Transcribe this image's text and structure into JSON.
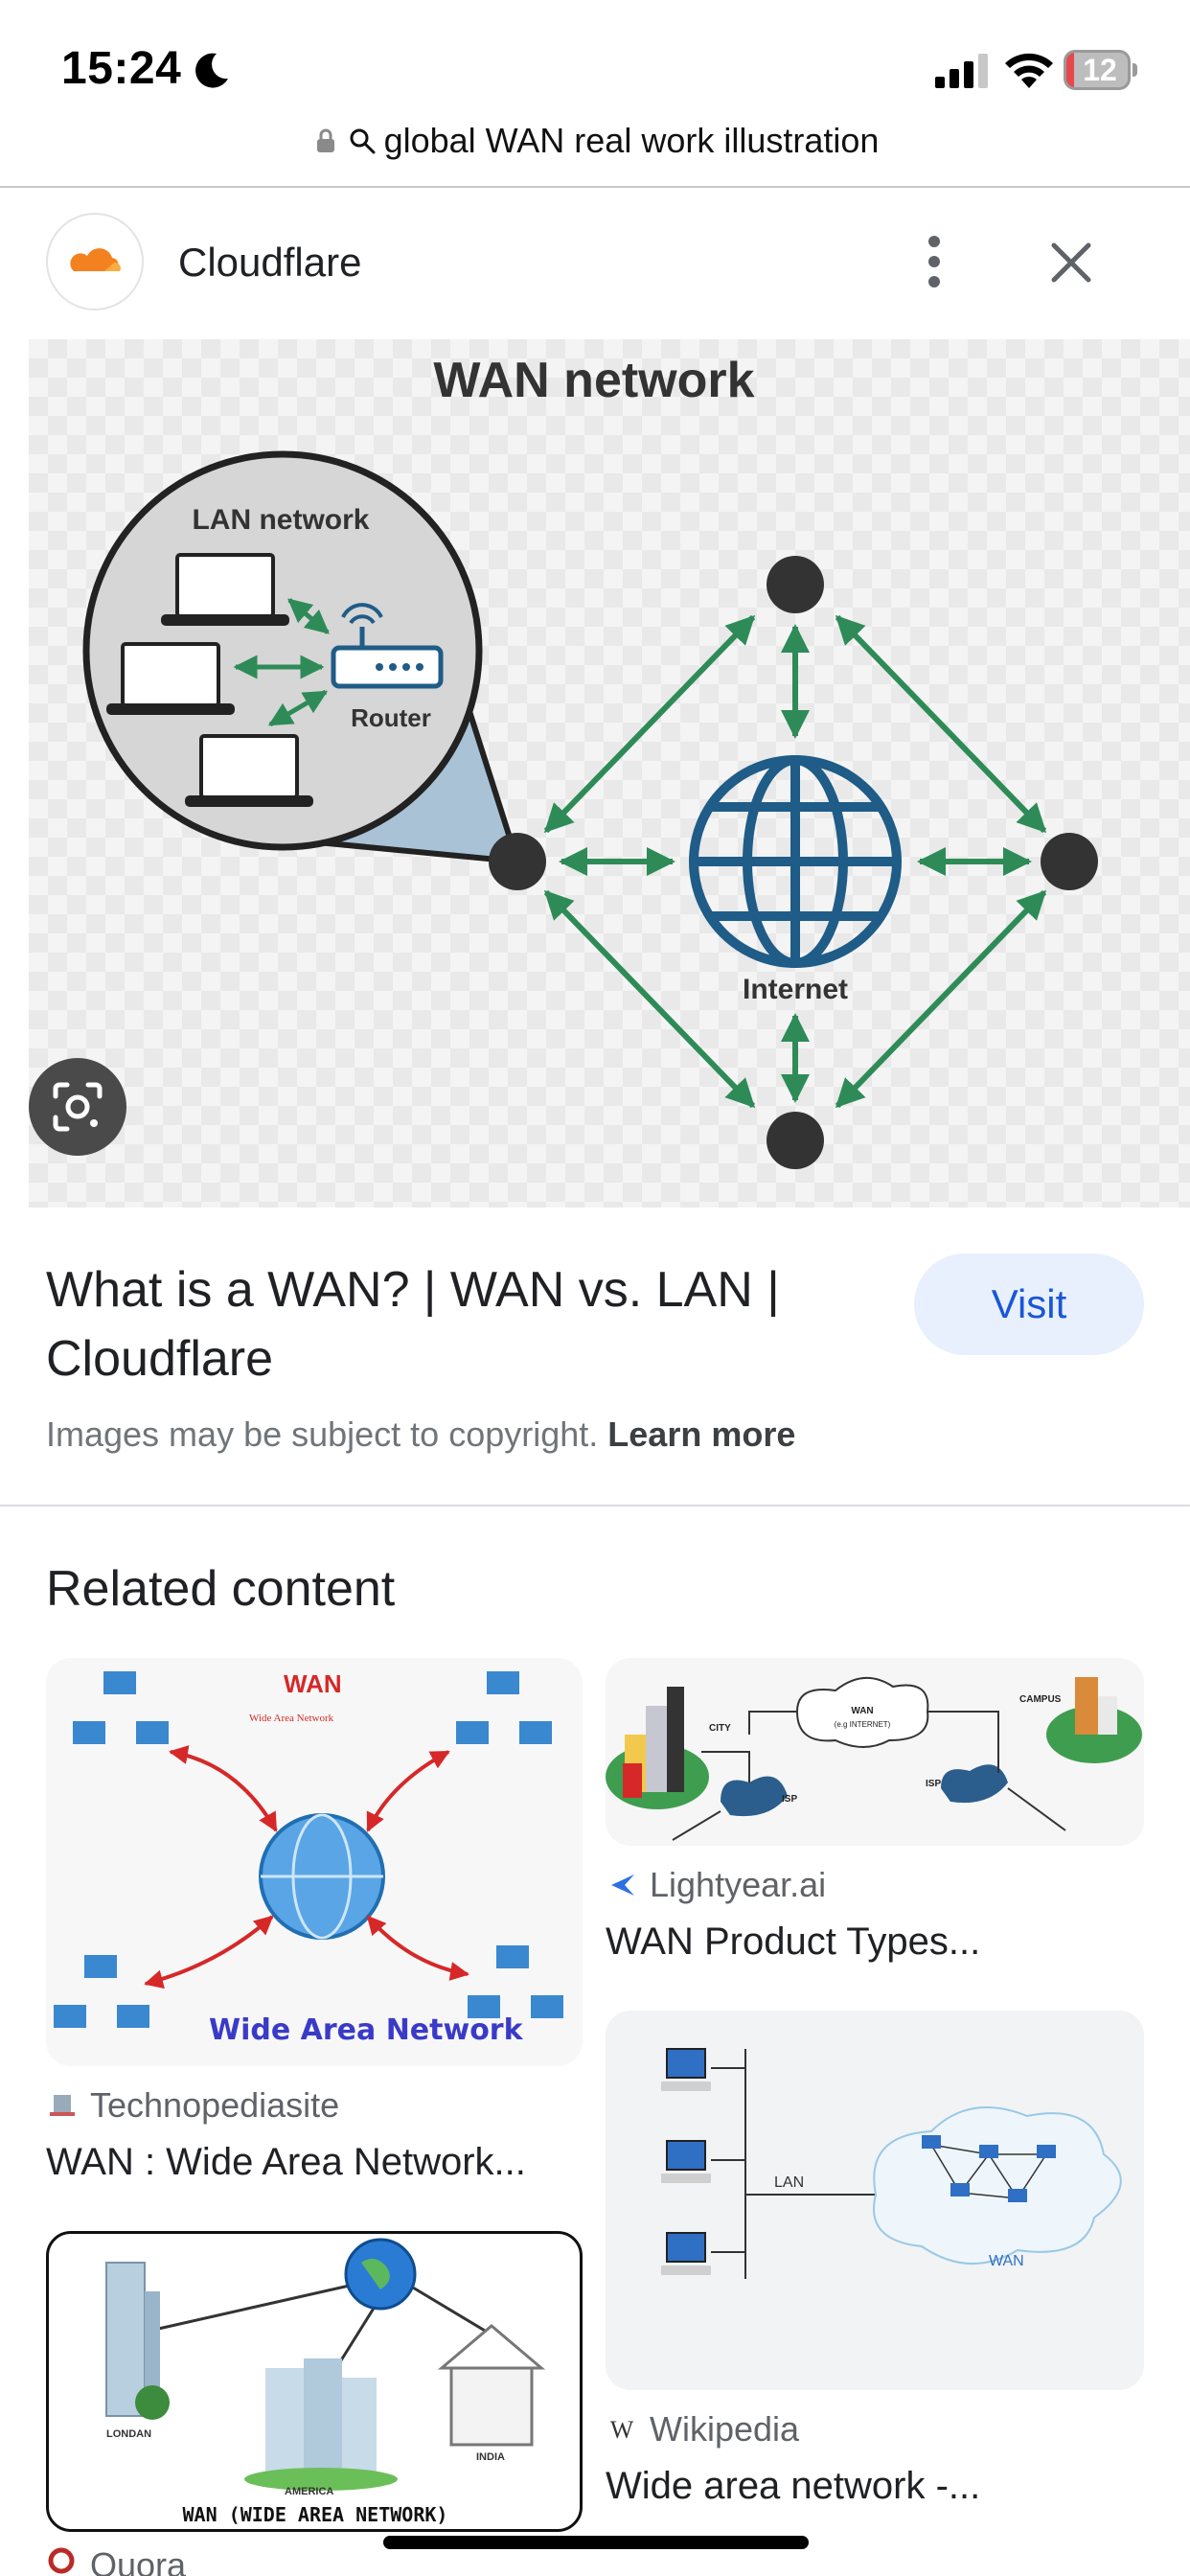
{
  "status_bar": {
    "time": "15:24",
    "battery": "12",
    "battery_level_pct": 12
  },
  "url_bar": {
    "query": "global WAN real work illustration"
  },
  "source": {
    "name": "Cloudflare"
  },
  "main_image": {
    "title": "WAN network",
    "lan_label": "LAN network",
    "router_label": "Router",
    "internet_label": "Internet"
  },
  "result": {
    "title": "What is a WAN? | WAN vs. LAN | Cloudflare",
    "visit_label": "Visit",
    "copyright_text": "Images may be subject to copyright. ",
    "learn_more": "Learn more"
  },
  "related": {
    "heading": "Related content",
    "items": [
      {
        "source": "Technopediasite",
        "title": "WAN : Wide Area Network...",
        "image_text": {
          "wan": "WAN",
          "sub": "Wide Area Network",
          "caption": "Wide Area Network"
        }
      },
      {
        "source": "Lightyear.ai",
        "title": "WAN Product Types...",
        "image_text": {
          "city": "CITY",
          "wan": "WAN",
          "wan_sub": "(e.g INTERNET)",
          "campus": "CAMPUS",
          "isp1": "ISP",
          "isp2": "ISP"
        }
      },
      {
        "source": "Wikipedia",
        "title": "Wide area network -...",
        "image_text": {
          "lan": "LAN",
          "wan": "WAN"
        }
      },
      {
        "source": "Quora",
        "title": "",
        "image_text": {
          "london": "LONDAN",
          "america": "AMERICA",
          "india": "INDIA",
          "caption": "WAN (WIDE AREA NETWORK)"
        }
      }
    ]
  },
  "colors": {
    "accent": "#1a57d6",
    "visit_bg": "#e8f0fe",
    "arrow_green": "#2e8b57",
    "globe_blue": "#1f5c87"
  }
}
